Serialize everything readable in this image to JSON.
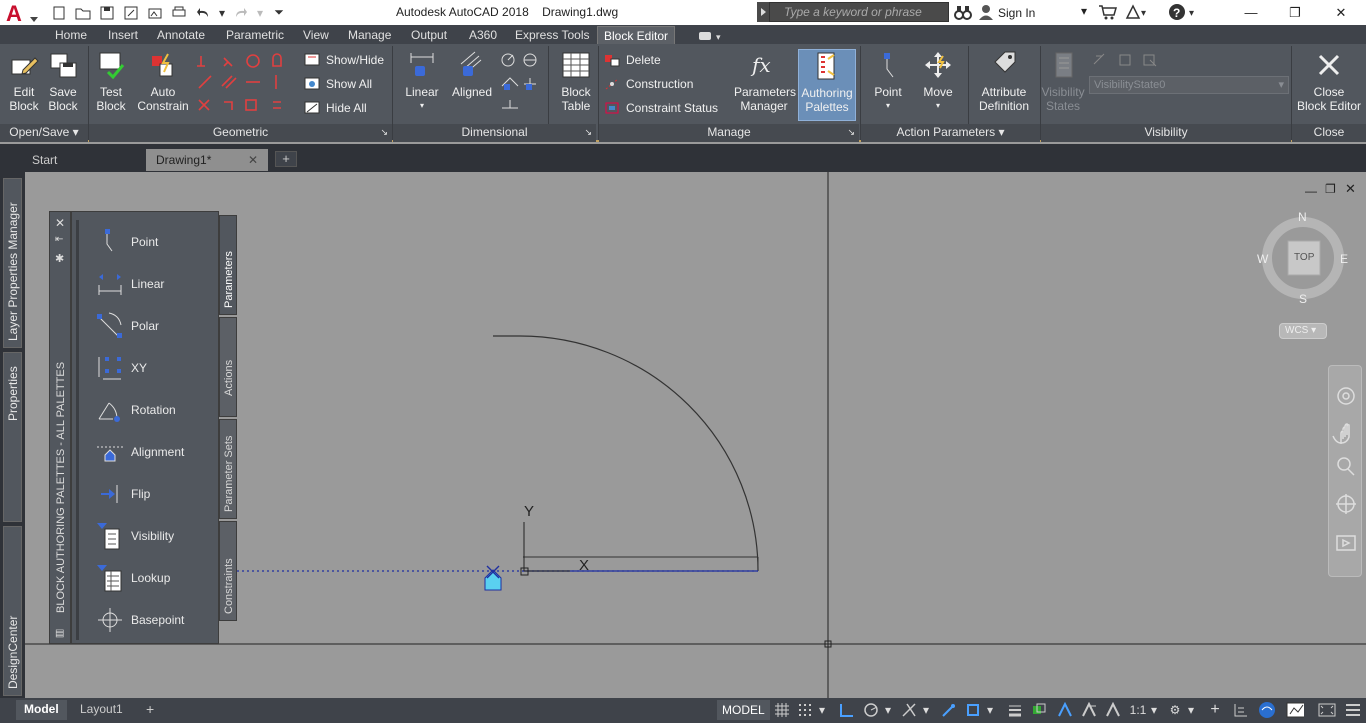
{
  "titlebar": {
    "app_title": "Autodesk AutoCAD 2018    Drawing1.dwg",
    "search_placeholder": "Type a keyword or phrase",
    "sign_in": "Sign In"
  },
  "ribbon_tabs": [
    "Home",
    "Insert",
    "Annotate",
    "Parametric",
    "View",
    "Manage",
    "Output",
    "A360",
    "Express Tools",
    "Block Editor"
  ],
  "ribbon_active_tab": "Block Editor",
  "panels": {
    "open_save": {
      "title": "Open/Save",
      "edit_block": "Edit\nBlock",
      "save_block": "Save\nBlock"
    },
    "geometric": {
      "title": "Geometric",
      "test_block": "Test\nBlock",
      "auto_constrain": "Auto\nConstrain",
      "show_hide": "Show/Hide",
      "show_all": "Show All",
      "hide_all": "Hide All"
    },
    "dimensional": {
      "title": "Dimensional",
      "linear": "Linear",
      "aligned": "Aligned"
    },
    "manage": {
      "title": "Manage",
      "block_table": "Block\nTable",
      "delete": "Delete",
      "construction": "Construction",
      "constraint_status": "Constraint Status",
      "parameters_manager": "Parameters\nManager",
      "authoring_palettes": "Authoring\nPalettes"
    },
    "action_parameters": {
      "title": "Action Parameters",
      "point": "Point",
      "move": "Move",
      "attribute_definition": "Attribute\nDefinition"
    },
    "visibility": {
      "title": "Visibility",
      "visibility_states": "Visibility\nStates",
      "state_value": "VisibilityState0"
    },
    "close": {
      "title": "Close",
      "close_block_editor": "Close\nBlock Editor"
    }
  },
  "file_tabs": [
    "Start",
    "Drawing1*"
  ],
  "left_side_tabs": [
    "Layer Properties Manager",
    "Properties",
    "DesignCenter"
  ],
  "palette": {
    "title": "BLOCK AUTHORING PALETTES - ALL PALETTES",
    "items": [
      "Point",
      "Linear",
      "Polar",
      "XY",
      "Rotation",
      "Alignment",
      "Flip",
      "Visibility",
      "Lookup",
      "Basepoint"
    ],
    "tabs": [
      "Parameters",
      "Actions",
      "Parameter Sets",
      "Constraints"
    ]
  },
  "viewcube": {
    "top": "TOP",
    "n": "N",
    "s": "S",
    "e": "E",
    "w": "W",
    "wcs": "WCS"
  },
  "canvas": {
    "ucs_y": "Y",
    "ucs_x": "X"
  },
  "status": {
    "model_tab": "Model",
    "layout_tab": "Layout1",
    "model_label": "MODEL",
    "scale": "1:1"
  },
  "colors": {
    "accent": "#c0a060",
    "ribbon_bg": "#52575e",
    "canvas_bg": "#9a9a9a",
    "highlight_button": "#6b8fb8",
    "parameter_blue": "#1f2fa0",
    "grip_cyan": "#5ad0f0"
  }
}
